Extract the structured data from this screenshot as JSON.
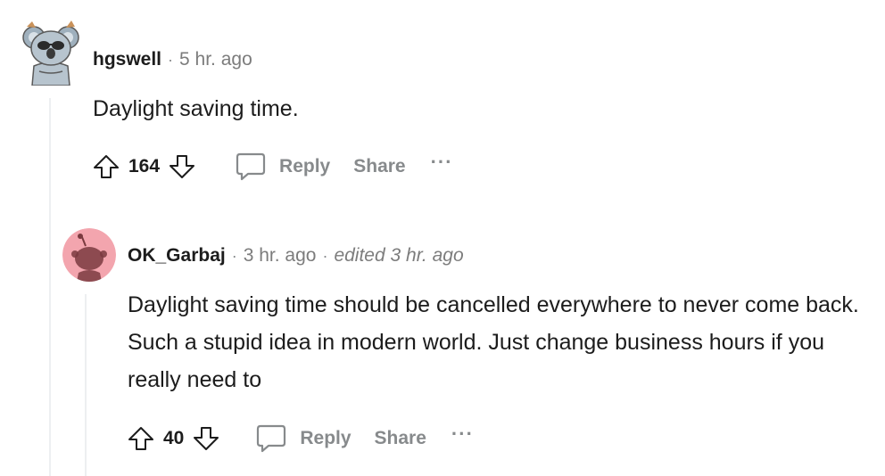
{
  "comments": [
    {
      "username": "hgswell",
      "separator": "·",
      "time": "5 hr. ago",
      "body": "Daylight saving time.",
      "score": "164",
      "reply_label": "Reply",
      "share_label": "Share",
      "more_label": "···",
      "avatar_icon": "koala-avatar-icon"
    },
    {
      "username": "OK_Garbaj",
      "separator": "·",
      "time": "3 hr. ago",
      "separator2": "·",
      "edited": "edited 3 hr. ago",
      "body": "Daylight saving time should be cancelled everywhere to never come back. Such a stupid idea in modern world. Just change business hours if you really need to",
      "score": "40",
      "reply_label": "Reply",
      "share_label": "Share",
      "more_label": "···",
      "avatar_icon": "snoo-avatar-icon"
    }
  ],
  "colors": {
    "thread_line": "#edeff1",
    "muted_text": "#878a8c",
    "avatar2_bg": "#f3a5ae",
    "avatar2_figure": "#7a3a3f"
  }
}
